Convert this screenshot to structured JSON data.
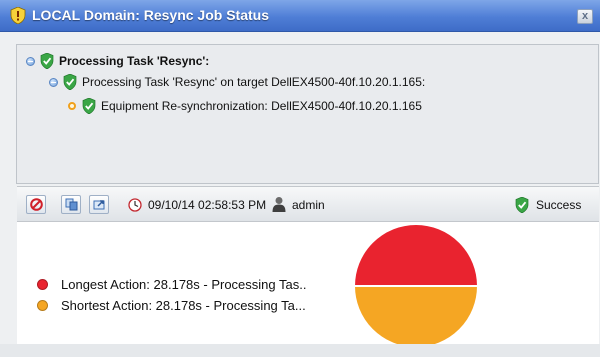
{
  "window": {
    "title": "LOCAL Domain: Resync Job Status",
    "close_label": "x"
  },
  "tree": {
    "root_label": "Processing Task 'Resync':",
    "child_label": "Processing Task 'Resync' on target DellEX4500-40f.10.20.1.165:",
    "leaf_label": "Equipment Re-synchronization: DellEX4500-40f.10.20.1.165"
  },
  "toolbar": {
    "timestamp": "09/10/14 02:58:53 PM",
    "user": "admin",
    "status": "Success"
  },
  "chart_data": {
    "type": "pie",
    "legend": [
      {
        "label": "Longest Action: 28.178s - Processing Tas..",
        "color": "#e9232f"
      },
      {
        "label": "Shortest Action: 28.178s - Processing Ta...",
        "color": "#f5a623"
      }
    ],
    "slices": [
      {
        "name": "Longest Action",
        "value": 28.178,
        "color": "#e9232f"
      },
      {
        "name": "Shortest Action",
        "value": 28.178,
        "color": "#f5a623"
      }
    ]
  },
  "colors": {
    "titlebar": "#4f7ed6",
    "success_green": "#3aa646",
    "longest": "#e9232f",
    "shortest": "#f5a623"
  }
}
